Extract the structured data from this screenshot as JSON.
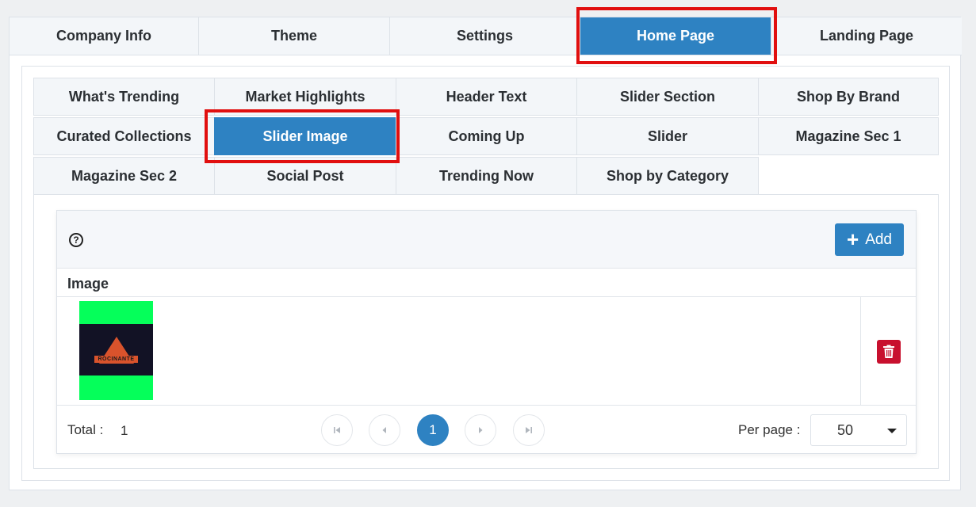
{
  "top_tabs": [
    {
      "label": "Company Info"
    },
    {
      "label": "Theme"
    },
    {
      "label": "Settings"
    },
    {
      "label": "Home Page"
    },
    {
      "label": "Landing Page"
    }
  ],
  "sub_tabs": [
    {
      "label": "What's Trending"
    },
    {
      "label": "Market Highlights"
    },
    {
      "label": "Header Text"
    },
    {
      "label": "Slider Section"
    },
    {
      "label": "Shop By Brand"
    },
    {
      "label": "Curated Collections"
    },
    {
      "label": "Slider Image"
    },
    {
      "label": "Coming Up"
    },
    {
      "label": "Slider"
    },
    {
      "label": "Magazine Sec 1"
    },
    {
      "label": "Magazine Sec 2"
    },
    {
      "label": "Social Post"
    },
    {
      "label": "Trending Now"
    },
    {
      "label": "Shop by Category"
    }
  ],
  "grid": {
    "help_icon": "?",
    "add_label": "Add",
    "column_header": "Image",
    "thumbnail_text": "ROCINANTE",
    "footer": {
      "total_label": "Total :",
      "total_value": "1",
      "current_page": "1",
      "per_page_label": "Per page :",
      "per_page_value": "50"
    }
  },
  "colors": {
    "accent": "#2e82c2",
    "highlight": "#e10f0f",
    "delete": "#c8102e",
    "thumb_bg": "#05ff5a"
  }
}
